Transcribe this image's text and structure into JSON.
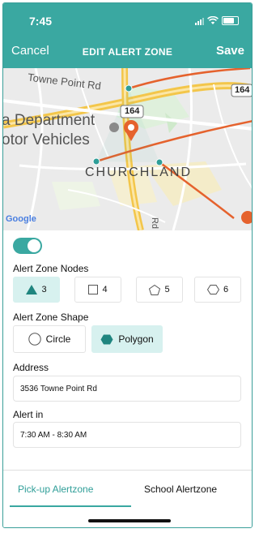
{
  "status_bar": {
    "time": "7:45"
  },
  "header": {
    "cancel_label": "Cancel",
    "title": "EDIT ALERT ZONE",
    "save_label": "Save"
  },
  "map": {
    "labels": {
      "towne_point": "Towne Point Rd",
      "department": "a Department",
      "motor_vehicles": "otor Vehicles",
      "churchland": "CHURCHLAND",
      "route_164_a": "164",
      "route_164_b": "164",
      "vertical_road": "Rd",
      "google": "Google"
    }
  },
  "form": {
    "toggle_on": true,
    "nodes_label": "Alert Zone Nodes",
    "node_options": [
      {
        "count": "3",
        "icon": "triangle-icon",
        "selected": true
      },
      {
        "count": "4",
        "icon": "square-icon",
        "selected": false
      },
      {
        "count": "5",
        "icon": "pentagon-icon",
        "selected": false
      },
      {
        "count": "6",
        "icon": "hexagon-icon",
        "selected": false
      }
    ],
    "shape_label": "Alert Zone Shape",
    "shape_options": [
      {
        "label": "Circle",
        "icon": "circle-icon",
        "selected": false
      },
      {
        "label": "Polygon",
        "icon": "hexagon-icon",
        "selected": true
      }
    ],
    "address_label": "Address",
    "address_value": "3536 Towne Point Rd",
    "alert_in_label": "Alert in",
    "alert_in_value": "7:30 AM - 8:30 AM"
  },
  "tabs": [
    {
      "label": "Pick-up Alertzone",
      "active": true
    },
    {
      "label": "School Alertzone",
      "active": false
    }
  ],
  "colors": {
    "accent": "#3aa8a1",
    "route": "#e5622d",
    "highway": "#f3c64a"
  }
}
